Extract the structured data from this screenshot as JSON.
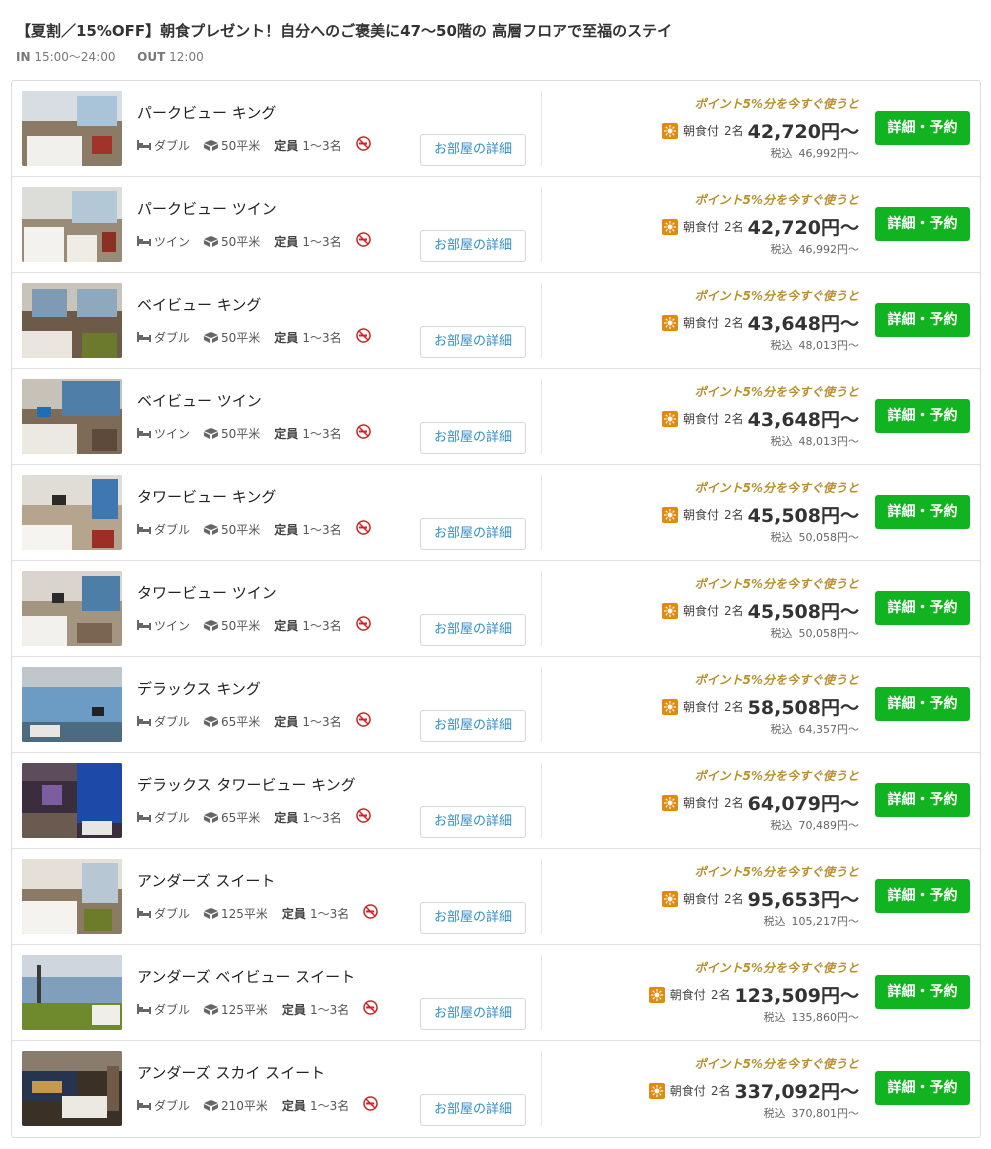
{
  "plan": {
    "title": "【夏割／15%OFF】朝食プレゼント！自分へのご褒美に47〜50階の 高層フロアで至福のステイ",
    "in_label": "IN",
    "in_time": "15:00〜24:00",
    "out_label": "OUT",
    "out_time": "12:00"
  },
  "labels": {
    "detail_button": "お部屋の詳細",
    "book_button": "詳細・予約",
    "points_note": "ポイント5%分を今すぐ使うと",
    "meal": "朝食付",
    "capacity_label": "定員",
    "tax_label": "税込"
  },
  "colors": {
    "accent_green": "#12b321",
    "link_blue": "#2f8ec9",
    "points_gold": "#b8902c",
    "meal_orange": "#e08a10",
    "nosmoke_red": "#cc2222"
  },
  "icons": {
    "bed": "bed-icon",
    "area": "cube-icon",
    "meal": "meal-icon",
    "nosmoking": "no-smoking-icon"
  },
  "rooms": [
    {
      "name": "パークビュー キング",
      "bed": "ダブル",
      "size": "50平米",
      "capacity": "1〜3名",
      "guests": "2名",
      "price": "42,720円〜",
      "tax_price": "46,992円〜"
    },
    {
      "name": "パークビュー ツイン",
      "bed": "ツイン",
      "size": "50平米",
      "capacity": "1〜3名",
      "guests": "2名",
      "price": "42,720円〜",
      "tax_price": "46,992円〜"
    },
    {
      "name": "ベイビュー キング",
      "bed": "ダブル",
      "size": "50平米",
      "capacity": "1〜3名",
      "guests": "2名",
      "price": "43,648円〜",
      "tax_price": "48,013円〜"
    },
    {
      "name": "ベイビュー ツイン",
      "bed": "ツイン",
      "size": "50平米",
      "capacity": "1〜3名",
      "guests": "2名",
      "price": "43,648円〜",
      "tax_price": "48,013円〜"
    },
    {
      "name": "タワービュー キング",
      "bed": "ダブル",
      "size": "50平米",
      "capacity": "1〜3名",
      "guests": "2名",
      "price": "45,508円〜",
      "tax_price": "50,058円〜"
    },
    {
      "name": "タワービュー ツイン",
      "bed": "ツイン",
      "size": "50平米",
      "capacity": "1〜3名",
      "guests": "2名",
      "price": "45,508円〜",
      "tax_price": "50,058円〜"
    },
    {
      "name": "デラックス キング",
      "bed": "ダブル",
      "size": "65平米",
      "capacity": "1〜3名",
      "guests": "2名",
      "price": "58,508円〜",
      "tax_price": "64,357円〜"
    },
    {
      "name": "デラックス タワービュー キング",
      "bed": "ダブル",
      "size": "65平米",
      "capacity": "1〜3名",
      "guests": "2名",
      "price": "64,079円〜",
      "tax_price": "70,489円〜"
    },
    {
      "name": "アンダーズ スイート",
      "bed": "ダブル",
      "size": "125平米",
      "capacity": "1〜3名",
      "guests": "2名",
      "price": "95,653円〜",
      "tax_price": "105,217円〜"
    },
    {
      "name": "アンダーズ ベイビュー スイート",
      "bed": "ダブル",
      "size": "125平米",
      "capacity": "1〜3名",
      "guests": "2名",
      "price": "123,509円〜",
      "tax_price": "135,860円〜"
    },
    {
      "name": "アンダーズ スカイ スイート",
      "bed": "ダブル",
      "size": "210平米",
      "capacity": "1〜3名",
      "guests": "2名",
      "price": "337,092円〜",
      "tax_price": "370,801円〜"
    }
  ]
}
